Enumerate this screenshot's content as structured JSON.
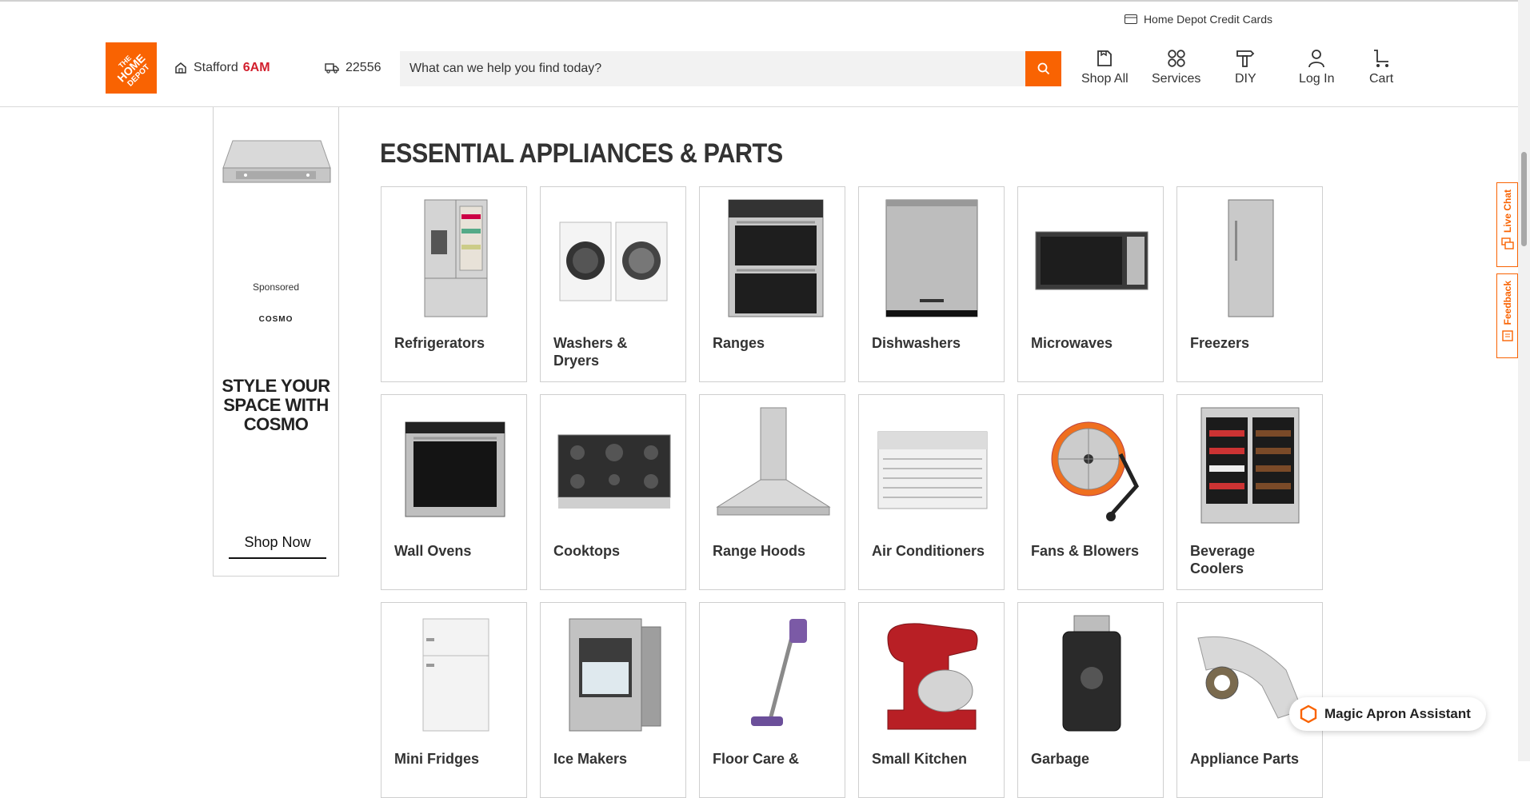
{
  "utility": {
    "credit_cards": "Home Depot Credit Cards"
  },
  "header": {
    "logo_text": "THE HOME DEPOT",
    "store_name": "Stafford",
    "store_hours": "6AM",
    "zip": "22556",
    "search_placeholder": "What can we help you find today?",
    "nav": {
      "shop_all": "Shop All",
      "services": "Services",
      "diy": "DIY",
      "log_in": "Log In",
      "cart": "Cart"
    }
  },
  "ad": {
    "sponsored": "Sponsored",
    "brand": "COSMO",
    "tagline": "STYLE YOUR SPACE WITH COSMO",
    "cta": "Shop Now"
  },
  "section": {
    "title": "ESSENTIAL APPLIANCES & PARTS"
  },
  "categories": [
    {
      "label": "Refrigerators"
    },
    {
      "label": "Washers & Dryers"
    },
    {
      "label": "Ranges"
    },
    {
      "label": "Dishwashers"
    },
    {
      "label": "Microwaves"
    },
    {
      "label": "Freezers"
    },
    {
      "label": "Wall Ovens"
    },
    {
      "label": "Cooktops"
    },
    {
      "label": "Range Hoods"
    },
    {
      "label": "Air Conditioners"
    },
    {
      "label": "Fans & Blowers"
    },
    {
      "label": "Beverage Coolers"
    },
    {
      "label": "Mini Fridges"
    },
    {
      "label": "Ice Makers"
    },
    {
      "label": "Floor Care &"
    },
    {
      "label": "Small Kitchen"
    },
    {
      "label": "Garbage"
    },
    {
      "label": "Appliance Parts"
    }
  ],
  "side_tabs": {
    "live_chat": "Live Chat",
    "feedback": "Feedback"
  },
  "assistant": {
    "label": "Magic Apron Assistant"
  },
  "colors": {
    "brand_orange": "#f96302",
    "hours_red": "#d21f2d"
  }
}
